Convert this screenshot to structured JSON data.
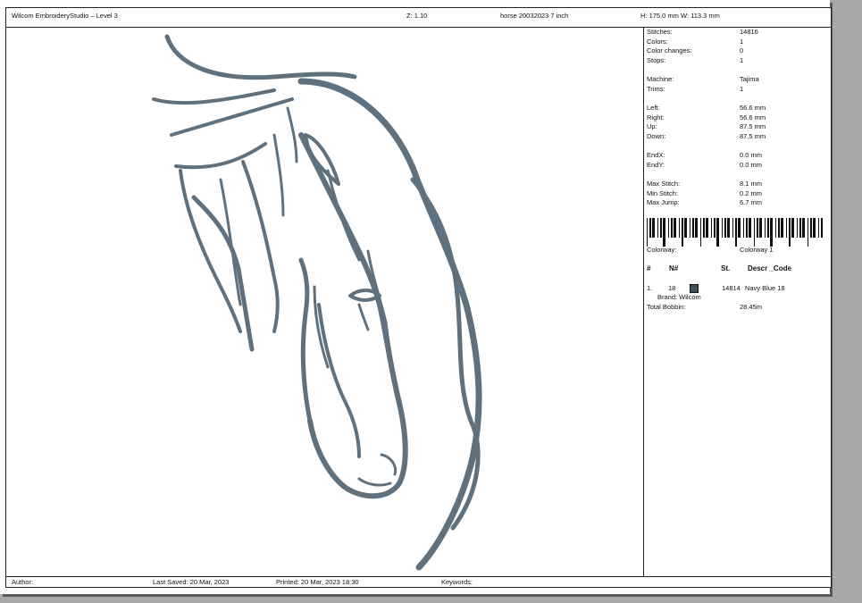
{
  "header": {
    "app_title": "Wilcom EmbroideryStudio – Level 3",
    "zoom": "Z: 1.10",
    "design_name": "horse 20032023 7 inch",
    "size": "H: 175.0 mm   W: 113.3 mm"
  },
  "stats": {
    "stitches": {
      "label": "Stitches:",
      "value": "14816"
    },
    "colors": {
      "label": "Colors:",
      "value": "1"
    },
    "color_changes": {
      "label": "Color changes:",
      "value": "0"
    },
    "stops": {
      "label": "Stops:",
      "value": "1"
    },
    "machine": {
      "label": "Machine:",
      "value": "Tajima"
    },
    "trims": {
      "label": "Trims:",
      "value": "1"
    },
    "left": {
      "label": "Left:",
      "value": "56.6 mm"
    },
    "right": {
      "label": "Right:",
      "value": "56.6 mm"
    },
    "up": {
      "label": "Up:",
      "value": "87.5 mm"
    },
    "down": {
      "label": "Down:",
      "value": "87.5 mm"
    },
    "endx": {
      "label": "EndX:",
      "value": "0.0 mm"
    },
    "endy": {
      "label": "EndY:",
      "value": "0.0 mm"
    },
    "max_stitch": {
      "label": "Max Stitch:",
      "value": "8.1 mm"
    },
    "min_stitch": {
      "label": "Min Stitch:",
      "value": "0.2 mm"
    },
    "max_jump": {
      "label": "Max Jump:",
      "value": "6.7 mm"
    }
  },
  "colorway": {
    "label": "Colorway:",
    "value": "Colorway 1"
  },
  "color_table": {
    "headers": {
      "num": "#",
      "n": "N#",
      "st": "St.",
      "descr": "Descr _Code"
    },
    "rows": [
      {
        "index": "1.",
        "n": "18",
        "swatch": "#3f4f5c",
        "stitches": "14814",
        "descr": "Navy Blue 18",
        "brand": "Brand: Wilcom"
      }
    ]
  },
  "total_bobbin": {
    "label": "Total Bobbin:",
    "value": "28.45m"
  },
  "footer": {
    "author": "Author:",
    "last_saved": "Last Saved: 20 Mar, 2023",
    "printed": "Printed: 20 Mar, 2023 18:30",
    "keywords": "Keywords:"
  },
  "thread_color": "#5f717e"
}
